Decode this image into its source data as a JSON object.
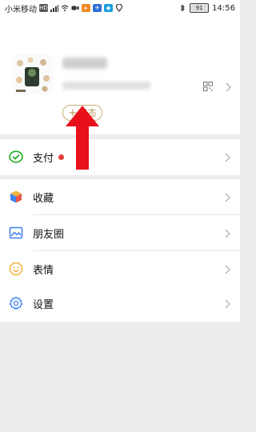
{
  "status_bar": {
    "carrier": "小米移动",
    "time": "14:56",
    "battery": "91"
  },
  "profile": {
    "status_button_plus": "+",
    "status_button_label": "状态"
  },
  "menu": {
    "pay": {
      "label": "支付",
      "icon": "wechat-pay-icon"
    },
    "favorites": {
      "label": "收藏",
      "icon": "favorites-cube-icon"
    },
    "moments": {
      "label": "朋友圈",
      "icon": "moments-image-icon"
    },
    "stickers": {
      "label": "表情",
      "icon": "smiley-icon"
    },
    "settings": {
      "label": "设置",
      "icon": "gear-icon"
    }
  },
  "colors": {
    "accent_gold": "#b8965a",
    "pay_green": "#1aad19",
    "arrow_red": "#e8101a",
    "background": "#ededed"
  }
}
